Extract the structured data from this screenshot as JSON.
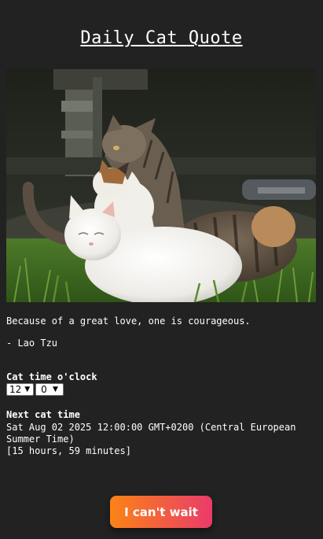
{
  "header": {
    "title": "Daily Cat Quote"
  },
  "quote": {
    "text": "Because of a great love, one is courageous.",
    "author": "- Lao Tzu"
  },
  "cat_time": {
    "label": "Cat time o'clock",
    "hour_value": "12",
    "minute_value": "0"
  },
  "next": {
    "label": "Next cat time",
    "date": "Sat Aug 02 2025 12:00:00 GMT+0200 (Central European Summer Time)",
    "countdown": "[15 hours, 59 minutes]"
  },
  "button": {
    "label": "I can't wait",
    "gradient_start": "#fb8316",
    "gradient_end": "#ea3b6a"
  },
  "colors": {
    "background": "#222222",
    "text": "#ffffff"
  }
}
